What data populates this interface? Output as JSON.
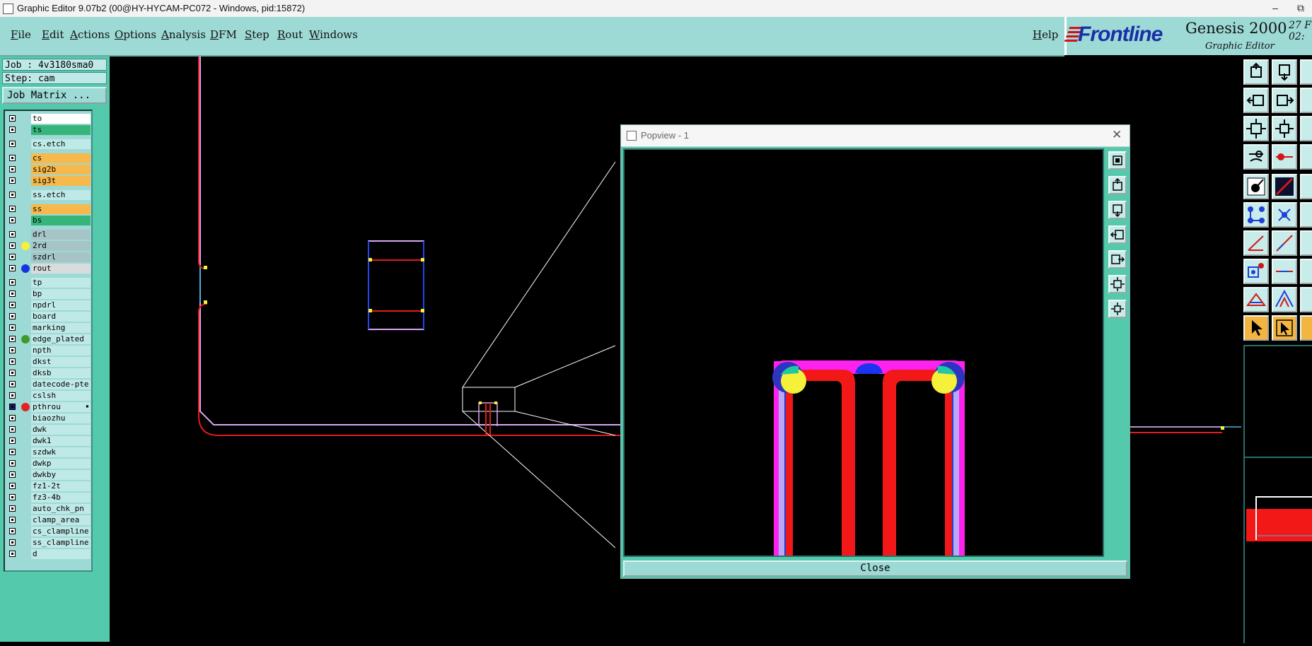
{
  "window": {
    "title": "Graphic Editor 9.07b2 (00@HY-HYCAM-PC072 - Windows, pid:15872)",
    "minimize_glyph": "–",
    "restore_glyph": "⧉"
  },
  "menu": {
    "items": [
      "File",
      "Edit",
      "Actions",
      "Options",
      "Analysis",
      "DFM",
      "Step",
      "Rout",
      "Windows"
    ],
    "help": "Help"
  },
  "logo": {
    "brand": "Frontline",
    "product": "Genesis 2000",
    "subtitle": "Graphic Editor",
    "date_line1": "27 F",
    "date_line2": "02:"
  },
  "job": {
    "job_label": "Job : 4v3180sma0",
    "step_label": "Step: cam",
    "matrix_button": "Job Matrix ..."
  },
  "colors": {
    "teal": "#9dd9d5",
    "layer_default": "#bfe9e7",
    "layer_orange": "#f7b94b",
    "layer_green": "#36b57a",
    "layer_gray": "#a6c4c6",
    "layer_white": "#ffffff",
    "layer_light": "#d8dcdc"
  },
  "layers": [
    {
      "name": "to",
      "color": "#ffffff",
      "dot": ""
    },
    {
      "name": "ts",
      "color": "#36b57a",
      "dot": ""
    },
    {
      "name": "cs.etch",
      "color": "#bfe9e7",
      "dot": "",
      "gap": true
    },
    {
      "name": "cs",
      "color": "#f7b94b",
      "dot": "",
      "gap": true
    },
    {
      "name": "sig2b",
      "color": "#f7b94b",
      "dot": ""
    },
    {
      "name": "sig3t",
      "color": "#f7b94b",
      "dot": ""
    },
    {
      "name": "ss.etch",
      "color": "#bfe9e7",
      "dot": "",
      "gap": true
    },
    {
      "name": "ss",
      "color": "#f7b94b",
      "dot": "",
      "gap": true
    },
    {
      "name": "bs",
      "color": "#36b57a",
      "dot": ""
    },
    {
      "name": "drl",
      "color": "#a6c4c6",
      "dot": "",
      "gap": true
    },
    {
      "name": "2rd",
      "color": "#a6c4c6",
      "dot": "#f5f03a"
    },
    {
      "name": "szdrl",
      "color": "#a6c4c6",
      "dot": ""
    },
    {
      "name": "rout",
      "color": "#d8dcdc",
      "dot": "#1733e0"
    },
    {
      "name": "tp",
      "color": "#bfe9e7",
      "dot": "",
      "gap": true
    },
    {
      "name": "bp",
      "color": "#bfe9e7",
      "dot": ""
    },
    {
      "name": "npdrl",
      "color": "#bfe9e7",
      "dot": ""
    },
    {
      "name": "board",
      "color": "#bfe9e7",
      "dot": ""
    },
    {
      "name": "marking",
      "color": "#bfe9e7",
      "dot": ""
    },
    {
      "name": "edge_plated",
      "color": "#bfe9e7",
      "dot": "#3f9a2d"
    },
    {
      "name": "npth",
      "color": "#bfe9e7",
      "dot": ""
    },
    {
      "name": "dkst",
      "color": "#bfe9e7",
      "dot": ""
    },
    {
      "name": "dksb",
      "color": "#bfe9e7",
      "dot": ""
    },
    {
      "name": "datecode-pte",
      "color": "#bfe9e7",
      "dot": ""
    },
    {
      "name": "cslsh",
      "color": "#bfe9e7",
      "dot": ""
    },
    {
      "name": "pthrou",
      "color": "#bfe9e7",
      "dot": "#e42222",
      "active": true
    },
    {
      "name": "biaozhu",
      "color": "#bfe9e7",
      "dot": ""
    },
    {
      "name": "dwk",
      "color": "#bfe9e7",
      "dot": ""
    },
    {
      "name": "dwk1",
      "color": "#bfe9e7",
      "dot": ""
    },
    {
      "name": "szdwk",
      "color": "#bfe9e7",
      "dot": ""
    },
    {
      "name": "dwkp",
      "color": "#bfe9e7",
      "dot": ""
    },
    {
      "name": "dwkby",
      "color": "#bfe9e7",
      "dot": ""
    },
    {
      "name": "fz1-2t",
      "color": "#bfe9e7",
      "dot": ""
    },
    {
      "name": "fz3-4b",
      "color": "#bfe9e7",
      "dot": ""
    },
    {
      "name": "auto_chk_pn",
      "color": "#bfe9e7",
      "dot": ""
    },
    {
      "name": "clamp_area",
      "color": "#bfe9e7",
      "dot": ""
    },
    {
      "name": "cs_clampline",
      "color": "#bfe9e7",
      "dot": ""
    },
    {
      "name": "ss_clampline",
      "color": "#bfe9e7",
      "dot": ""
    },
    {
      "name": "d",
      "color": "#bfe9e7",
      "dot": ""
    }
  ],
  "popview": {
    "title": "Popview - 1",
    "close_label": "Close"
  }
}
